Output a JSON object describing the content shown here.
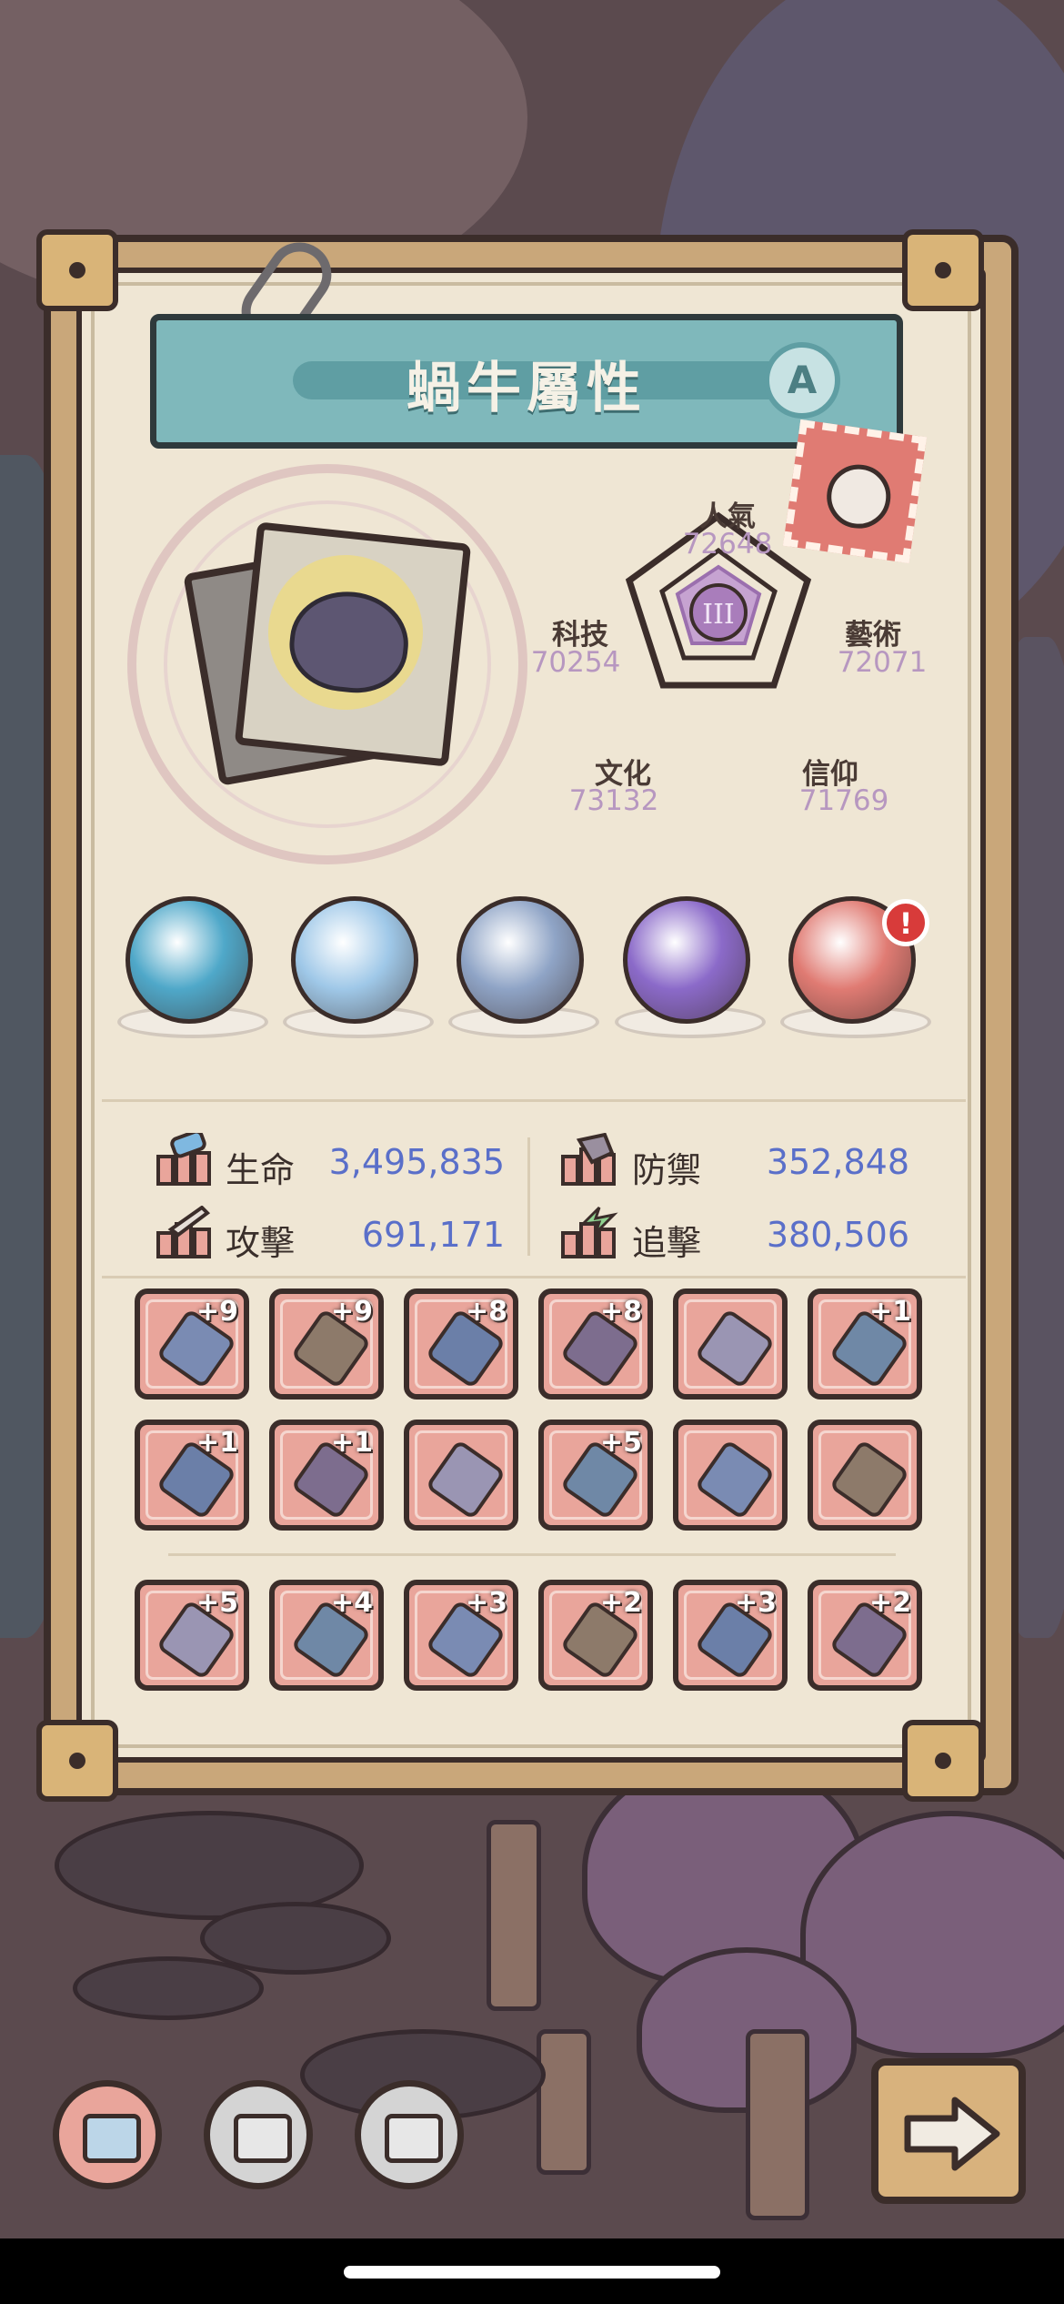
{
  "panel": {
    "title": "蝸牛屬性",
    "rank": "A"
  },
  "attributes": {
    "popularity": {
      "label": "人氣",
      "value": "72648"
    },
    "art": {
      "label": "藝術",
      "value": "72071"
    },
    "faith": {
      "label": "信仰",
      "value": "71769"
    },
    "culture": {
      "label": "文化",
      "value": "73132"
    },
    "tech": {
      "label": "科技",
      "value": "70254"
    },
    "center_badge": "III"
  },
  "orbs": [
    {
      "icon": "sea-monster-orb-icon",
      "color": "#4fa8c9"
    },
    {
      "icon": "moon-orb-icon",
      "color": "#9fc8e8"
    },
    {
      "icon": "compass-orb-icon",
      "color": "#8fa4c6"
    },
    {
      "icon": "galaxy-orb-icon",
      "color": "#8b6ac9"
    },
    {
      "icon": "flame-orb-icon",
      "color": "#e07b73",
      "alert": "!"
    }
  ],
  "stats": {
    "hp": {
      "label": "生命",
      "value": "3,495,835"
    },
    "defense": {
      "label": "防禦",
      "value": "352,848"
    },
    "attack": {
      "label": "攻擊",
      "value": "691,171"
    },
    "chase": {
      "label": "追擊",
      "value": "380,506"
    }
  },
  "equipment_rows": [
    [
      {
        "icon": "rocket-icon",
        "level": "+9"
      },
      {
        "icon": "crossbow-icon",
        "level": "+9"
      },
      {
        "icon": "sword-icon",
        "level": "+8"
      },
      {
        "icon": "serpent-staff-icon",
        "level": "+8"
      },
      {
        "icon": "crystal-icon",
        "level": ""
      },
      {
        "icon": "bracelet-icon",
        "level": "+1"
      }
    ],
    [
      {
        "icon": "helmet-icon",
        "level": "+1"
      },
      {
        "icon": "trident-icon",
        "level": "+1"
      },
      {
        "icon": "tablet-icon",
        "level": ""
      },
      {
        "icon": "spiked-club-icon",
        "level": "+5"
      },
      {
        "icon": "gold-ring-icon",
        "level": ""
      },
      {
        "icon": "pants-icon",
        "level": ""
      }
    ],
    [
      {
        "icon": "gauntlet-icon",
        "level": "+5"
      },
      {
        "icon": "boot-icon",
        "level": "+4"
      },
      {
        "icon": "spear-icon",
        "level": "+3"
      },
      {
        "icon": "flame-gun-icon",
        "level": "+2"
      },
      {
        "icon": "amulet-icon",
        "level": "+3"
      },
      {
        "icon": "armor-icon",
        "level": "+2"
      }
    ]
  ],
  "colors": {
    "title_bar": "#7fb8bb",
    "stat_value": "#5a6fc9",
    "attribute_value": "#b797c0",
    "slot_bg": "#e9a59b"
  }
}
